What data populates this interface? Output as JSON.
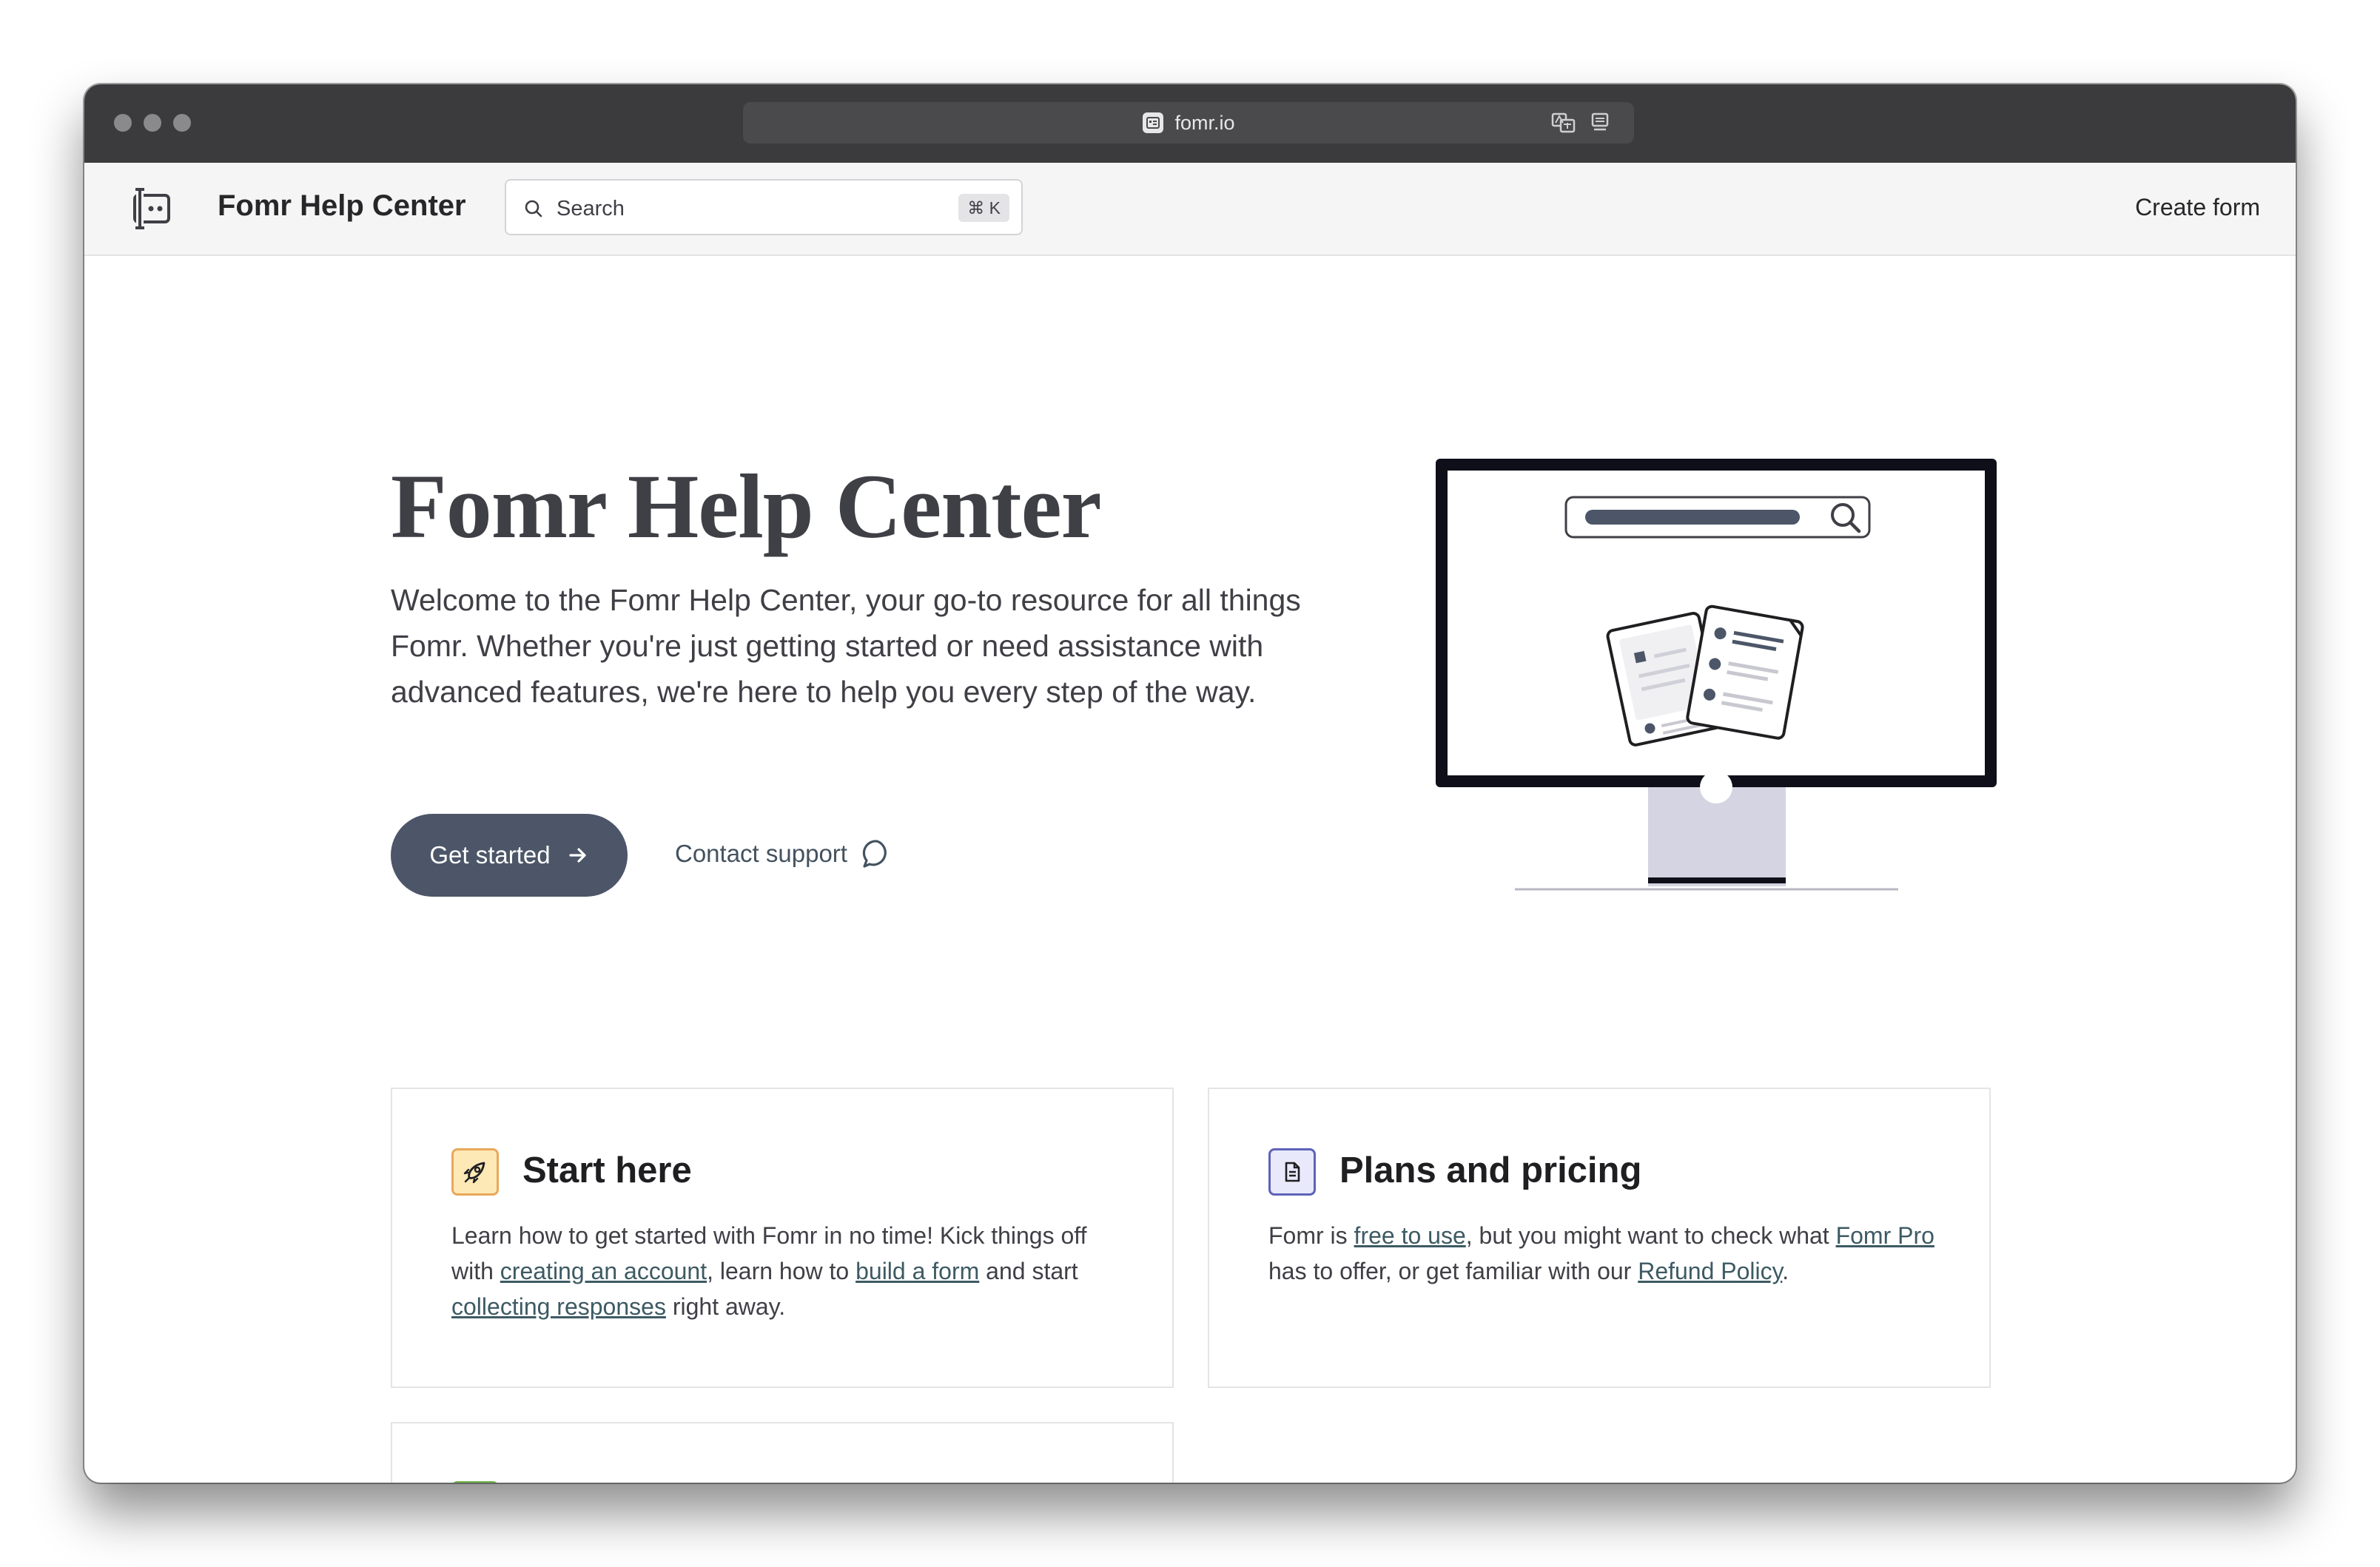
{
  "browser": {
    "url": "fomr.io"
  },
  "header": {
    "brand": "Fomr Help Center",
    "search_placeholder": "Search",
    "search_shortcut": "⌘ K",
    "create_form": "Create form"
  },
  "hero": {
    "title": "Fomr Help Center",
    "description": "Welcome to the Fomr Help Center, your go-to resource for all things Fomr. Whether you're just getting started or need assistance with advanced features, we're here to help you every step of the way.",
    "primary_button": "Get started",
    "secondary_button": "Contact support"
  },
  "cards": [
    {
      "title": "Start here",
      "icon": "rocket-icon",
      "text_1": "Learn how to get started with Fomr in no time! Kick things off with ",
      "link_1": "creating an account",
      "text_2": ", learn how to ",
      "link_2": "build a form",
      "text_3": " and start ",
      "link_3": "collecting responses",
      "text_4": " right away."
    },
    {
      "title": "Plans and pricing",
      "icon": "document-icon",
      "text_1": "Fomr is ",
      "link_1": "free to use",
      "text_2": ", but you might want to check what ",
      "link_2": "Fomr Pro",
      "text_3": " has to offer, or get familiar with our ",
      "link_3": "Refund Policy",
      "text_4": "."
    }
  ],
  "colors": {
    "primary_button": "#4c5668",
    "link": "#3d5a63",
    "titlebar": "#3b3b3d"
  }
}
